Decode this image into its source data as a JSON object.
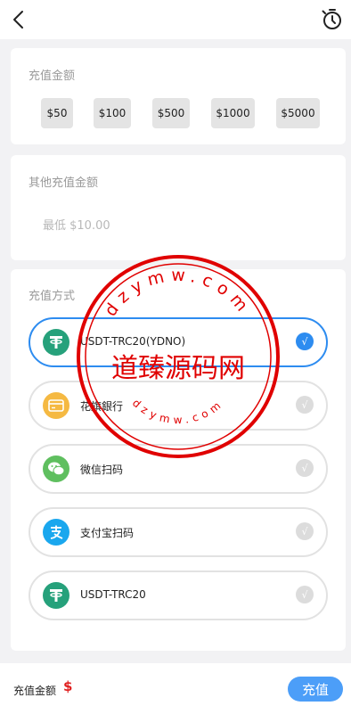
{
  "header": {
    "back_icon": "chevron-left-icon",
    "history_icon": "clock-history-icon"
  },
  "quick": {
    "title": "充值金额",
    "amounts": [
      "$50",
      "$100",
      "$500",
      "$1000",
      "$5000"
    ]
  },
  "other": {
    "title": "其他充值金额",
    "placeholder": "最低 $10.00"
  },
  "methods": {
    "title": "充值方式",
    "items": [
      {
        "label": "USDT-TRC20(YDNO)",
        "icon": "tether-icon",
        "color": "#26a17b",
        "selected": true
      },
      {
        "label": "花旗銀行",
        "icon": "bank-card-icon",
        "color": "#f5b942",
        "selected": false
      },
      {
        "label": "微信扫码",
        "icon": "wechat-icon",
        "color": "#5fbf5f",
        "selected": false
      },
      {
        "label": "支付宝扫码",
        "icon": "alipay-icon",
        "color": "#1aa7ee",
        "selected": false
      },
      {
        "label": "USDT-TRC20",
        "icon": "tether-icon",
        "color": "#26a17b",
        "selected": false
      }
    ],
    "check_glyph": "√"
  },
  "footer": {
    "label": "充值金额",
    "currency": "$",
    "submit": "充值"
  },
  "watermark": {
    "center_text": "道臻源码网",
    "top_text": "dzymw.com",
    "bottom_text": "dzymw.com",
    "color": "#e00000"
  },
  "colors": {
    "accent": "#2d8cf0",
    "button": "#4c9ef8",
    "price": "#e02020"
  }
}
